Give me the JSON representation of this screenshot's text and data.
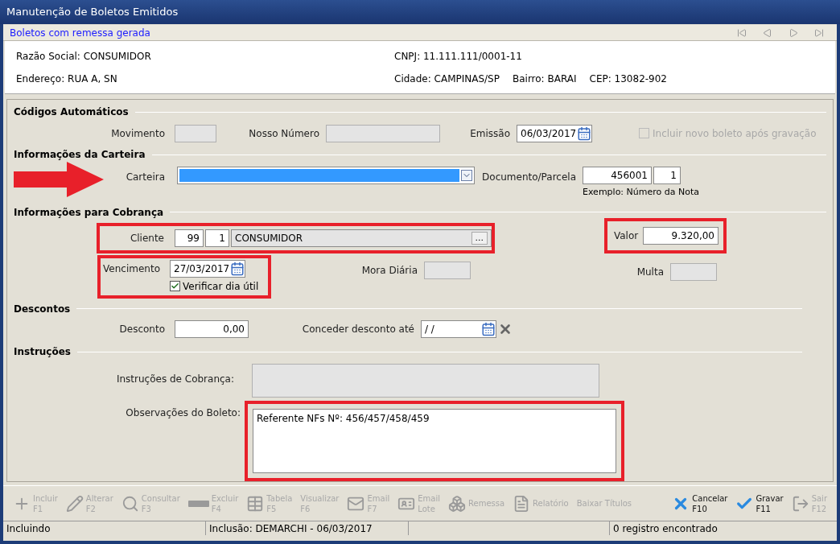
{
  "window": {
    "title": "Manutenção de Boletos Emitidos"
  },
  "header": {
    "subtitle": "Boletos com remessa gerada"
  },
  "customer": {
    "razao_social": "Razão Social: CONSUMIDOR",
    "endereco": "Endereço: RUA A, SN",
    "cnpj": "CNPJ: 11.111.111/0001-11",
    "cidade": "Cidade: CAMPINAS/SP",
    "bairro": "Bairro: BARAI",
    "cep": "CEP: 13082-902"
  },
  "codigos": {
    "title": "Códigos Automáticos",
    "movimento": {
      "label": "Movimento"
    },
    "nosso_numero": {
      "label": "Nosso Número"
    },
    "emissao": {
      "label": "Emissão",
      "value": "06/03/2017"
    },
    "incluir_novo": {
      "label": "Incluir novo boleto após gravação",
      "checked": false,
      "disabled": true
    }
  },
  "carteira": {
    "title": "Informações da Carteira",
    "carteira": {
      "label": "Carteira",
      "arrow": true
    },
    "documento": {
      "label": "Documento/Parcela",
      "value": "456001",
      "parcela": "1",
      "hint": "Exemplo: Número da Nota"
    }
  },
  "cobranca": {
    "title": "Informações para Cobrança",
    "cliente": {
      "label": "Cliente",
      "code": "99",
      "sub": "1",
      "name": "CONSUMIDOR",
      "button": "...",
      "highlighted": true
    },
    "valor": {
      "label": "Valor",
      "value": "9.320,00",
      "highlighted": true
    },
    "vencimento": {
      "label": "Vencimento",
      "value": "27/03/2017",
      "check_label": "Verificar dia útil",
      "checked": true,
      "highlighted": true
    },
    "mora": {
      "label": "Mora Diária"
    },
    "multa": {
      "label": "Multa"
    }
  },
  "descontos": {
    "title": "Descontos",
    "desconto": {
      "label": "Desconto",
      "value": "0,00"
    },
    "conceder": {
      "label": "Conceder desconto até",
      "value": "/ /"
    }
  },
  "instrucoes": {
    "title": "Instruções",
    "instrucoes": {
      "label": "Instruções de Cobrança:"
    },
    "observacoes": {
      "label": "Observações do Boleto:",
      "value": "Referente NFs Nº: 456/457/458/459",
      "highlighted": true
    }
  },
  "toolbar": [
    {
      "kind": "plus",
      "lines": [
        "Incluir",
        "F1"
      ],
      "disabled": true
    },
    {
      "kind": "pencil",
      "lines": [
        "Alterar",
        "F2"
      ],
      "disabled": true
    },
    {
      "kind": "search",
      "lines": [
        "Consultar",
        "F3"
      ],
      "disabled": true
    },
    {
      "kind": "minus",
      "lines": [
        "Excluir",
        "F4"
      ],
      "disabled": true
    },
    {
      "kind": "table",
      "lines": [
        "Tabela",
        "F5"
      ],
      "disabled": true
    },
    {
      "kind": "text",
      "lines": [
        "Visualizar",
        "F6"
      ],
      "disabled": true
    },
    {
      "kind": "mail",
      "lines": [
        "Email",
        "F7"
      ],
      "disabled": true
    },
    {
      "kind": "card",
      "lines": [
        "Email",
        "Lote"
      ],
      "disabled": true
    },
    {
      "kind": "boxes",
      "lines": [
        "Remessa"
      ],
      "disabled": true
    },
    {
      "kind": "report",
      "lines": [
        "Relatório"
      ],
      "disabled": true
    },
    {
      "kind": "text",
      "lines": [
        "Baixar Títulos"
      ],
      "disabled": true
    },
    {
      "kind": "cancel",
      "lines": [
        "Cancelar",
        "F10"
      ],
      "disabled": false
    },
    {
      "kind": "check",
      "lines": [
        "Gravar",
        "F11"
      ],
      "disabled": false
    },
    {
      "kind": "exit",
      "lines": [
        "Sair",
        "F12"
      ],
      "disabled": true
    }
  ],
  "status_bar": [
    "Incluindo",
    "Inclusão: DEMARCHI - 06/03/2017",
    "0 registro encontrado"
  ]
}
